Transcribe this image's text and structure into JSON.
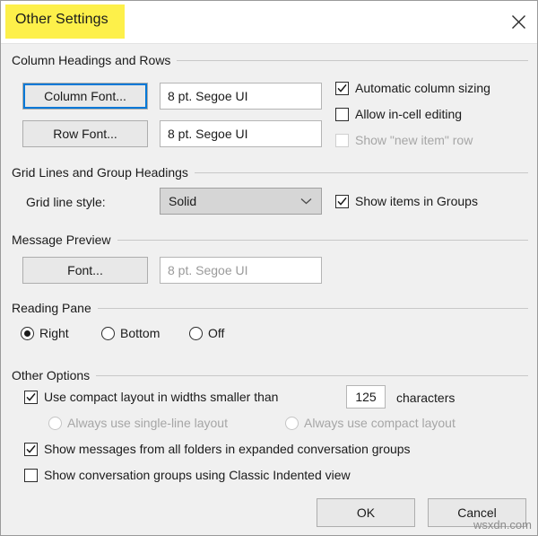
{
  "window": {
    "title": "Other Settings",
    "title_highlight_color": "#fdf04a",
    "close_icon": "close-icon",
    "background_color": "#f0f0f0",
    "accent_color": "#0078d7"
  },
  "sections": {
    "column_headings": {
      "label": "Column Headings and Rows",
      "column_font_button": "Column Font...",
      "column_font_value": "8 pt. Segoe UI",
      "row_font_button": "Row Font...",
      "row_font_value": "8 pt. Segoe UI",
      "checkboxes": [
        {
          "label": "Automatic column sizing",
          "checked": true,
          "enabled": true
        },
        {
          "label": "Allow in-cell editing",
          "checked": false,
          "enabled": true
        },
        {
          "label": "Show \"new item\" row",
          "checked": false,
          "enabled": false
        }
      ]
    },
    "grid_lines": {
      "label": "Grid Lines and Group Headings",
      "grid_line_style_label": "Grid line style:",
      "grid_line_style_value": "Solid",
      "grid_line_style_options": [
        "Solid"
      ],
      "show_items_in_groups": {
        "label": "Show items in Groups",
        "checked": true,
        "enabled": true
      }
    },
    "message_preview": {
      "label": "Message Preview",
      "font_button": "Font...",
      "font_value": "8 pt. Segoe UI",
      "font_value_enabled": false
    },
    "reading_pane": {
      "label": "Reading Pane",
      "options": [
        {
          "label": "Right",
          "selected": true
        },
        {
          "label": "Bottom",
          "selected": false
        },
        {
          "label": "Off",
          "selected": false
        }
      ]
    },
    "other_options": {
      "label": "Other Options",
      "compact_layout": {
        "label": "Use compact layout in widths smaller than",
        "checked": true,
        "enabled": true
      },
      "compact_width_value": "125",
      "characters_label": "characters",
      "layout_radios": [
        {
          "label": "Always use single-line layout",
          "selected": false,
          "enabled": false
        },
        {
          "label": "Always use compact layout",
          "selected": false,
          "enabled": false
        }
      ],
      "show_messages_all_folders": {
        "label": "Show messages from all folders in expanded conversation groups",
        "checked": true,
        "enabled": true
      },
      "classic_indented": {
        "label": "Show conversation groups using Classic Indented view",
        "checked": false,
        "enabled": true
      }
    }
  },
  "footer": {
    "ok_label": "OK",
    "cancel_label": "Cancel"
  },
  "watermark": "wsxdn.com"
}
